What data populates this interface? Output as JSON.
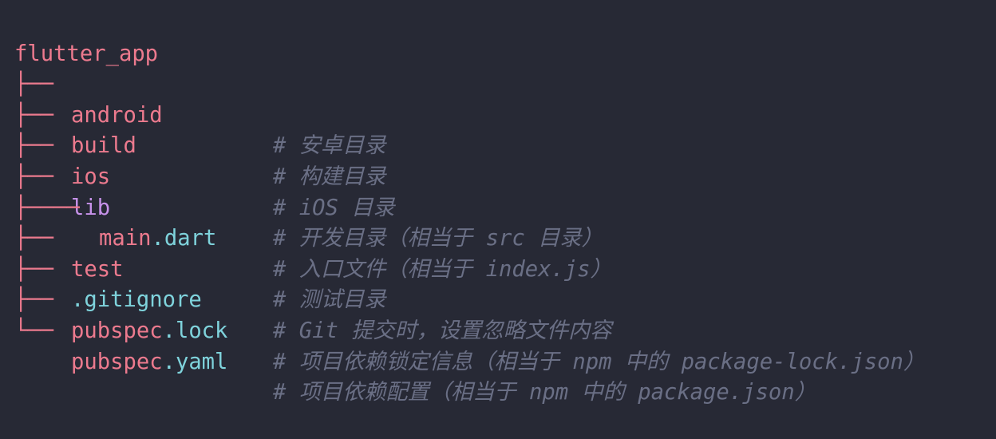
{
  "root": "flutter_app",
  "colors": {
    "background": "#272935",
    "tree_and_names": "#ec7a8e",
    "lib": "#c792ea",
    "extension": "#7fd3dc",
    "comment": "#6a6f85"
  },
  "entries": [
    {
      "prefix": "├── ",
      "name": "android",
      "comment": "# 安卓目录"
    },
    {
      "prefix": "├── ",
      "name": "build",
      "comment": "# 构建目录"
    },
    {
      "prefix": "├── ",
      "name": "ios",
      "comment": "# iOS 目录"
    },
    {
      "prefix": "├── ",
      "name": "lib",
      "comment": "# 开发目录（相当于 src 目录）"
    },
    {
      "prefix": "├──── ",
      "name_base": "main",
      "name_ext": ".dart",
      "comment": "# 入口文件（相当于 index.js）"
    },
    {
      "prefix": "├── ",
      "name": "test",
      "comment": "# 测试目录"
    },
    {
      "prefix": "├── ",
      "name_base": ".gitignore",
      "comment": "# Git 提交时，设置忽略文件内容"
    },
    {
      "prefix": "├── ",
      "name_base": "pubspec",
      "name_ext": ".lock",
      "comment": "# 项目依赖锁定信息（相当于 npm 中的 package-lock.json）"
    },
    {
      "prefix": "└── ",
      "name_base": "pubspec",
      "name_ext": ".yaml",
      "comment": "# 项目依赖配置（相当于 npm 中的 package.json）"
    }
  ]
}
